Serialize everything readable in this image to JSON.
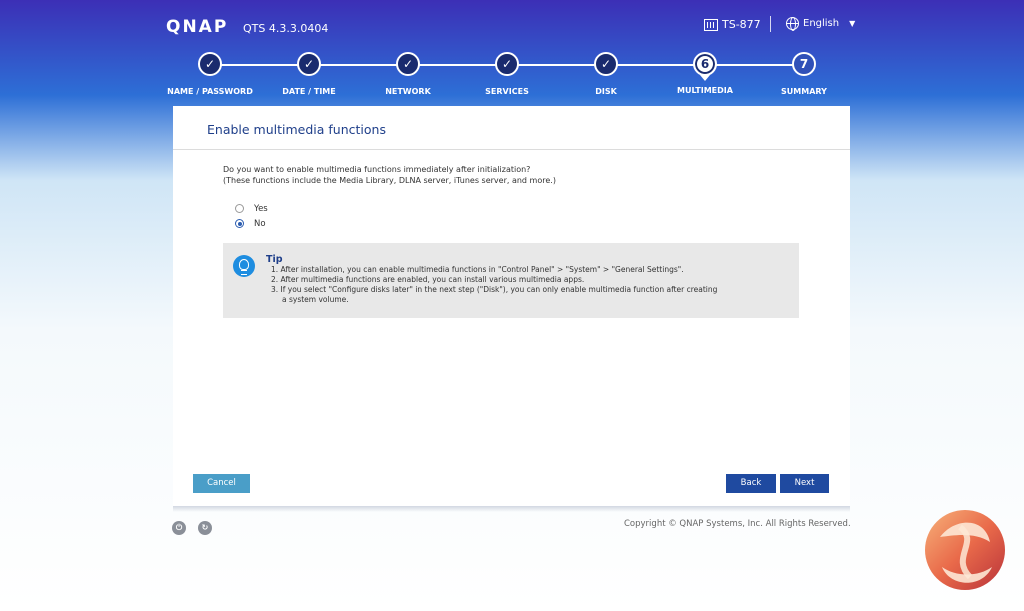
{
  "header": {
    "logo": "QNAP",
    "version": "QTS 4.3.3.0404",
    "model": "TS-877",
    "language": "English"
  },
  "steps": [
    {
      "label": "NAME / PASSWORD",
      "mark": "✓",
      "state": "done"
    },
    {
      "label": "DATE / TIME",
      "mark": "✓",
      "state": "done"
    },
    {
      "label": "NETWORK",
      "mark": "✓",
      "state": "done"
    },
    {
      "label": "SERVICES",
      "mark": "✓",
      "state": "done"
    },
    {
      "label": "DISK",
      "mark": "✓",
      "state": "done"
    },
    {
      "label": "MULTIMEDIA",
      "mark": "6",
      "state": "current"
    },
    {
      "label": "SUMMARY",
      "mark": "7",
      "state": "future"
    }
  ],
  "panel": {
    "title": "Enable multimedia functions",
    "question_line1": "Do you want to enable multimedia functions immediately after initialization?",
    "question_line2": "(These functions include the Media Library, DLNA server, iTunes server, and more.)",
    "options": [
      {
        "label": "Yes",
        "checked": false
      },
      {
        "label": "No",
        "checked": true
      }
    ],
    "tip": {
      "title": "Tip",
      "line1": "1. After installation, you can enable multimedia functions in \"Control Panel\" > \"System\" > \"General Settings\".",
      "line2": "2. After multimedia functions are enabled, you can install various multimedia apps.",
      "line3": "3. If you select \"Configure disks later\" in the next step (\"Disk\"), you can only enable multimedia function after creating",
      "line4": "a system volume."
    }
  },
  "buttons": {
    "cancel": "Cancel",
    "back": "Back",
    "next": "Next"
  },
  "footer": {
    "copyright": "Copyright © QNAP Systems, Inc. All Rights Reserved.",
    "power_icon": "power-icon",
    "restart_icon": "restart-icon"
  },
  "colors": {
    "accent": "#1f4aa0",
    "cancel": "#4a9ec8",
    "title": "#1f3f8a"
  }
}
